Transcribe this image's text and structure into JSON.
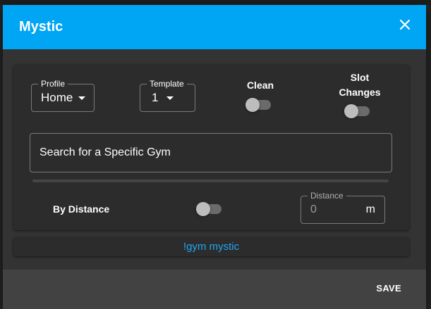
{
  "dialog": {
    "title": "Mystic",
    "close_icon": "close-icon",
    "header_color": "#00a5f4"
  },
  "filters": {
    "profile": {
      "label": "Profile",
      "value": "Home"
    },
    "template": {
      "label": "Template",
      "value": "1"
    },
    "clean": {
      "label": "Clean",
      "checked": false
    },
    "slot_changes": {
      "label_line1": "Slot",
      "label_line2": "Changes",
      "checked": false
    },
    "search": {
      "placeholder": "Search for a Specific Gym"
    },
    "by_distance": {
      "label": "By Distance",
      "checked": false
    },
    "distance": {
      "label": "Distance",
      "placeholder": "0",
      "unit": "m"
    }
  },
  "command": {
    "text": "!gym mystic",
    "color": "#1ea7f5"
  },
  "footer": {
    "save_label": "SAVE"
  }
}
